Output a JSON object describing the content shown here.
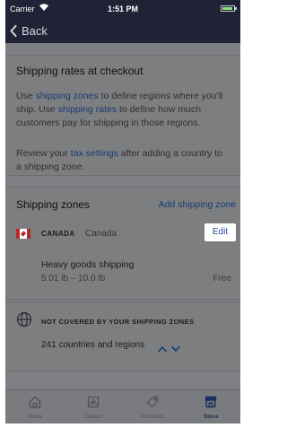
{
  "status_bar": {
    "carrier": "Carrier",
    "time": "1:51 PM",
    "battery_level": 0.9
  },
  "nav": {
    "back_label": "Back"
  },
  "checkout_card": {
    "title": "Shipping rates at checkout",
    "p1_a": "Use ",
    "p1_link1": "shipping zones",
    "p1_b": " to define regions where you'll ship. Use ",
    "p1_link2": "shipping rates",
    "p1_c": " to define how much customers pay for shipping in those regions.",
    "p2_a": "Review your ",
    "p2_link": "tax settings",
    "p2_b": " after adding a country to a shipping zone."
  },
  "zones_card": {
    "title": "Shipping zones",
    "add_label": "Add shipping zone",
    "zone": {
      "country_code": "CANADA",
      "country_name": "Canada",
      "edit_label": "Edit",
      "rate_name": "Heavy goods shipping",
      "rate_condition": "5.01 lb – 10.0 lb",
      "rate_price": "Free"
    }
  },
  "uncovered_card": {
    "heading": "NOT COVERED BY YOUR SHIPPING ZONES",
    "count_text": "241 countries and regions"
  },
  "tabs": [
    {
      "label": "Home",
      "icon": "home-icon"
    },
    {
      "label": "Orders",
      "icon": "orders-icon"
    },
    {
      "label": "Products",
      "icon": "tag-icon"
    },
    {
      "label": "Store",
      "icon": "store-icon",
      "active": true
    }
  ],
  "colors": {
    "navbar": "#1f2335",
    "link": "#163c74",
    "overlay": "#7e7f83",
    "edit_button_bg": "#ffffff",
    "edit_button_text": "#1d4d94"
  }
}
